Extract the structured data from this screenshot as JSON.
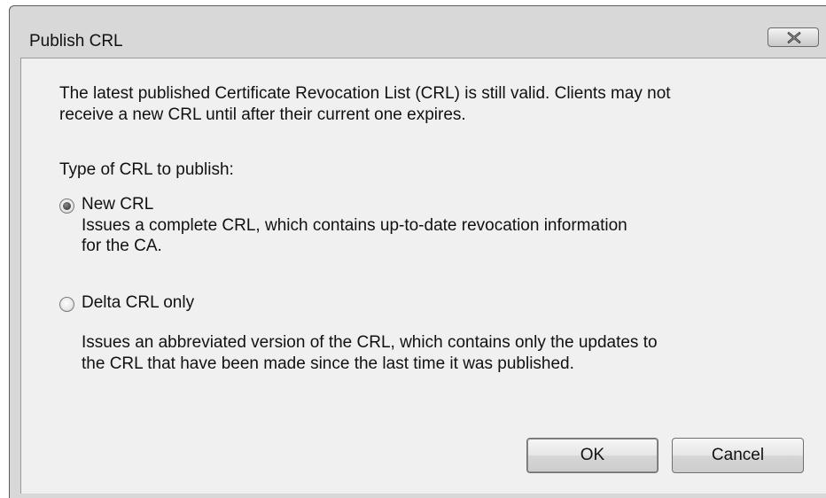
{
  "window": {
    "title": "Publish CRL",
    "close_icon": "close-icon"
  },
  "message": {
    "line1": "The latest published Certificate Revocation List (CRL) is still valid. Clients may not",
    "line2": "receive a new CRL until after their current one expires."
  },
  "crl_type": {
    "label": "Type of CRL to publish:",
    "selected": "new",
    "options": [
      {
        "id": "new",
        "label": "New CRL",
        "description_line1": "Issues a complete CRL, which contains up-to-date revocation information",
        "description_line2": "for the CA."
      },
      {
        "id": "delta",
        "label": "Delta CRL only",
        "description_line1": "Issues an abbreviated version of the CRL, which contains only the updates to",
        "description_line2": "the CRL that have been made since the last time it was published."
      }
    ]
  },
  "buttons": {
    "ok_label": "OK",
    "cancel_label": "Cancel"
  }
}
